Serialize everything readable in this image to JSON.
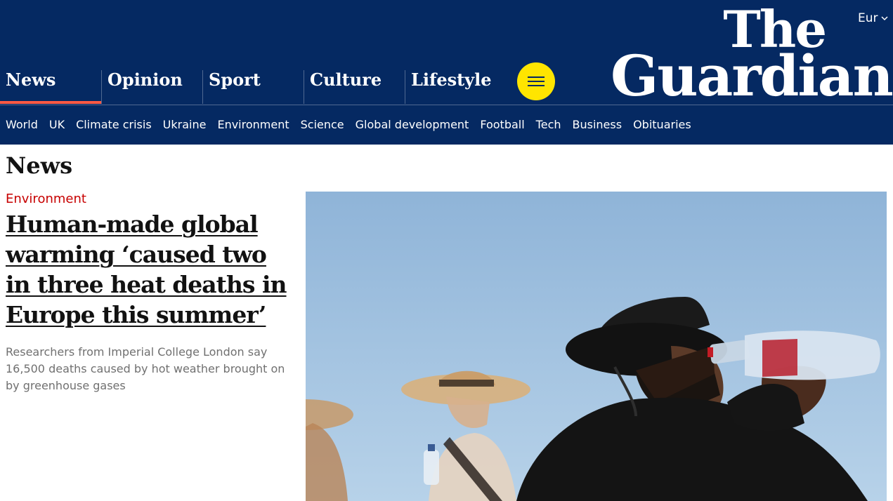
{
  "header": {
    "edition_label": "Eur",
    "logo_line1": "The",
    "logo_line2": "Guardian",
    "pillars": [
      {
        "label": "News",
        "active": true
      },
      {
        "label": "Opinion",
        "active": false
      },
      {
        "label": "Sport",
        "active": false
      },
      {
        "label": "Culture",
        "active": false
      },
      {
        "label": "Lifestyle",
        "active": false
      }
    ],
    "subnav": [
      "World",
      "UK",
      "Climate crisis",
      "Ukraine",
      "Environment",
      "Science",
      "Global development",
      "Football",
      "Tech",
      "Business",
      "Obituaries"
    ]
  },
  "icons": {
    "edition": "chevron-down-icon",
    "menu": "hamburger-menu-icon"
  },
  "colors": {
    "brand_blue": "#052962",
    "pillar_highlight": "#ff5943",
    "menu_button": "#ffe500",
    "kicker_red": "#c70000"
  },
  "main": {
    "section_title": "News",
    "article": {
      "kicker": "Environment",
      "headline": "Human-made global warming ‘caused two in three heat deaths in Europe this summer’",
      "standfirst": "Researchers from Imperial College London say 16,500 deaths caused by hot weather brought on by greenhouse gases"
    }
  }
}
